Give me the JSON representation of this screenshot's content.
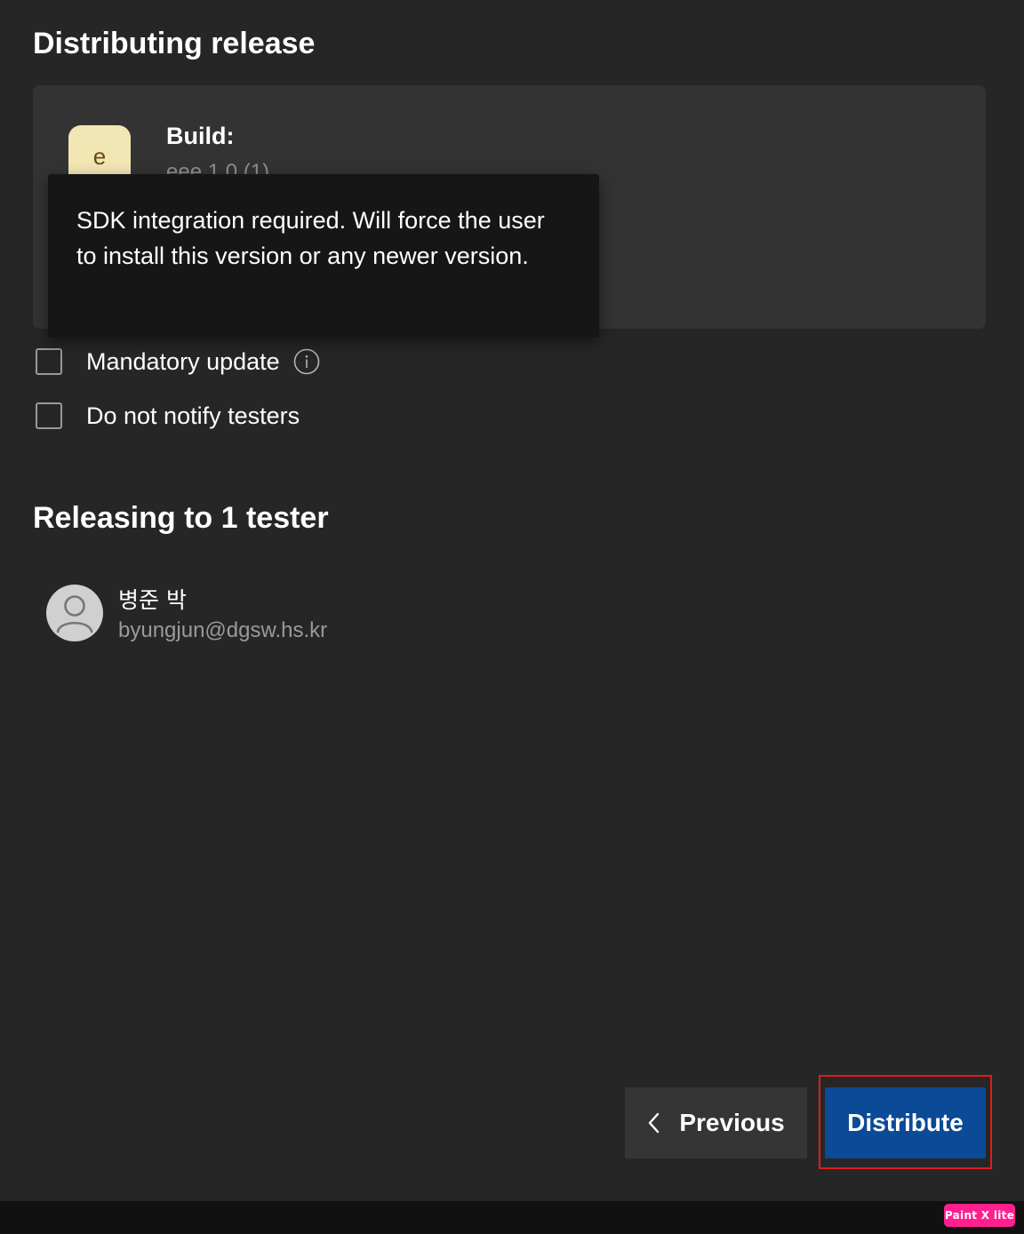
{
  "page": {
    "title": "Distributing release"
  },
  "build": {
    "app_icon_letter": "e",
    "label": "Build:",
    "version": "eee 1.0 (1)"
  },
  "tooltip": {
    "text": "SDK integration required. Will force the user to install this version or any newer version."
  },
  "options": {
    "mandatory_update": {
      "label": "Mandatory update",
      "checked": false,
      "info_icon": "info-icon"
    },
    "do_not_notify": {
      "label": "Do not notify testers",
      "checked": false
    }
  },
  "testers": {
    "heading": "Releasing to 1 tester",
    "list": [
      {
        "name": "병준 박",
        "email": "byungjun@dgsw.hs.kr",
        "avatar_icon": "user-avatar-icon"
      }
    ]
  },
  "footer": {
    "previous_label": "Previous",
    "previous_icon": "chevron-left-icon",
    "distribute_label": "Distribute"
  },
  "watermark": {
    "text": "Paint X lite"
  },
  "colors": {
    "background": "#262626",
    "card": "#333333",
    "tooltip": "#161616",
    "primary_button": "#0a4a96",
    "secondary_button": "#353535",
    "highlight": "#e11b1b",
    "app_icon": "#f3e6b5"
  }
}
